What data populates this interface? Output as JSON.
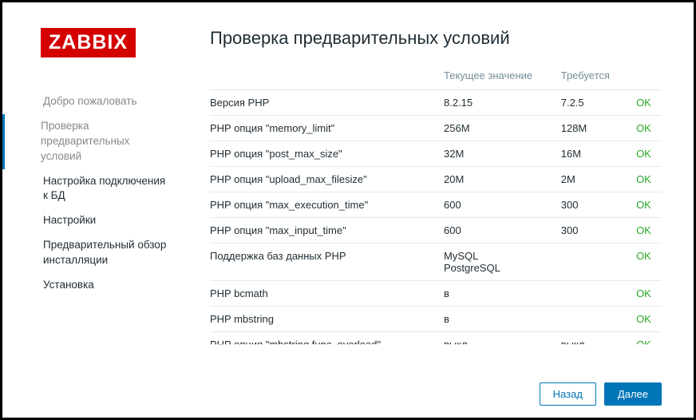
{
  "logo": "ZABBIX",
  "sidebar": {
    "steps": [
      {
        "label": "Добро пожаловать",
        "state": "visited"
      },
      {
        "label": "Проверка предварительных условий",
        "state": "current"
      },
      {
        "label": "Настройка подключения к БД",
        "state": "upcoming"
      },
      {
        "label": "Настройки",
        "state": "upcoming"
      },
      {
        "label": "Предварительный обзор инсталляции",
        "state": "upcoming"
      },
      {
        "label": "Установка",
        "state": "upcoming"
      }
    ]
  },
  "main": {
    "title": "Проверка предварительных условий",
    "headers": {
      "name": "",
      "current": "Текущее значение",
      "required": "Требуется",
      "status": ""
    },
    "rows": [
      {
        "name": "Версия PHP",
        "current": "8.2.15",
        "required": "7.2.5",
        "status": "OK"
      },
      {
        "name": "PHP опция \"memory_limit\"",
        "current": "256M",
        "required": "128M",
        "status": "OK"
      },
      {
        "name": "PHP опция \"post_max_size\"",
        "current": "32M",
        "required": "16M",
        "status": "OK"
      },
      {
        "name": "PHP опция \"upload_max_filesize\"",
        "current": "20M",
        "required": "2M",
        "status": "OK"
      },
      {
        "name": "PHP опция \"max_execution_time\"",
        "current": "600",
        "required": "300",
        "status": "OK"
      },
      {
        "name": "PHP опция \"max_input_time\"",
        "current": "600",
        "required": "300",
        "status": "OK"
      },
      {
        "name": "Поддержка баз данных PHP",
        "current": "MySQL\nPostgreSQL",
        "required": "",
        "status": "OK"
      },
      {
        "name": "PHP bcmath",
        "current": "в",
        "required": "",
        "status": "OK"
      },
      {
        "name": "PHP mbstring",
        "current": "в",
        "required": "",
        "status": "OK"
      },
      {
        "name": "PHP опция \"mbstring.func_overload\"",
        "current": "выкл",
        "required": "выкл",
        "status": "OK"
      }
    ]
  },
  "footer": {
    "back": "Назад",
    "next": "Далее"
  }
}
